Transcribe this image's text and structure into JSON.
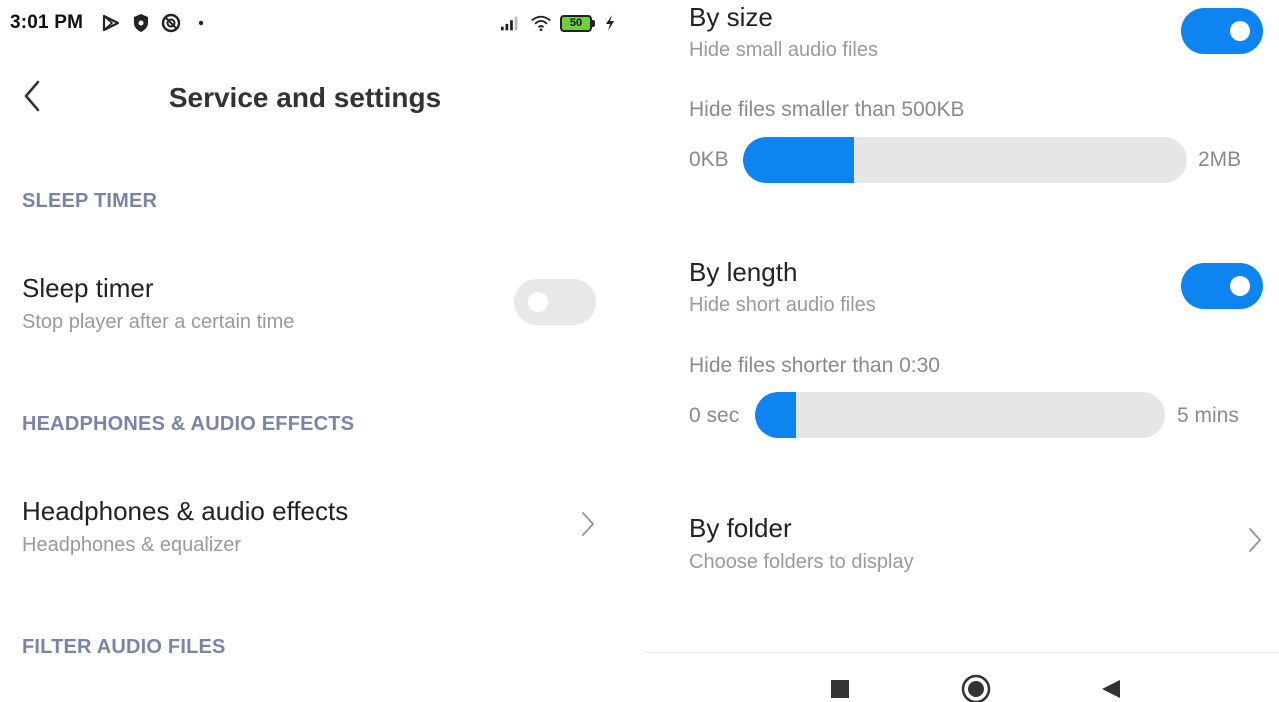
{
  "status_bar": {
    "time": "3:01 PM",
    "battery_level": "50",
    "left_icons": [
      "play-store-icon",
      "shield-icon",
      "do-not-disturb-icon",
      "dot-icon"
    ],
    "right_icons": [
      "signal-icon",
      "wifi-icon",
      "battery-icon",
      "charging-icon"
    ]
  },
  "header": {
    "back_icon": "chevron-left-icon",
    "title": "Service and settings"
  },
  "sections": {
    "sleep_timer": "SLEEP TIMER",
    "headphones": "HEADPHONES & AUDIO EFFECTS",
    "filter": "FILTER AUDIO FILES"
  },
  "sleep_timer": {
    "title": "Sleep timer",
    "subtitle": "Stop player after a certain time",
    "enabled": false
  },
  "headphones": {
    "title": "Headphones & audio effects",
    "subtitle": "Headphones & equalizer"
  },
  "by_size": {
    "title": "By size",
    "subtitle": "Hide small audio files",
    "enabled": true,
    "threshold_label": "Hide files smaller than 500KB",
    "min_label": "0KB",
    "max_label": "2MB",
    "value_fraction": 0.25
  },
  "by_length": {
    "title": "By length",
    "subtitle": "Hide short audio files",
    "enabled": true,
    "threshold_label": "Hide files shorter than 0:30",
    "min_label": "0 sec",
    "max_label": "5 mins",
    "value_fraction": 0.1
  },
  "by_folder": {
    "title": "By folder",
    "subtitle": "Choose folders to display"
  },
  "nav_bar": {
    "icons": [
      "recents-square-icon",
      "home-circle-icon",
      "back-triangle-icon"
    ]
  },
  "colors": {
    "accent": "#0d84f0",
    "section_header": "#7b84a6",
    "track": "#e6e6e6",
    "battery": "#6fd13a"
  }
}
